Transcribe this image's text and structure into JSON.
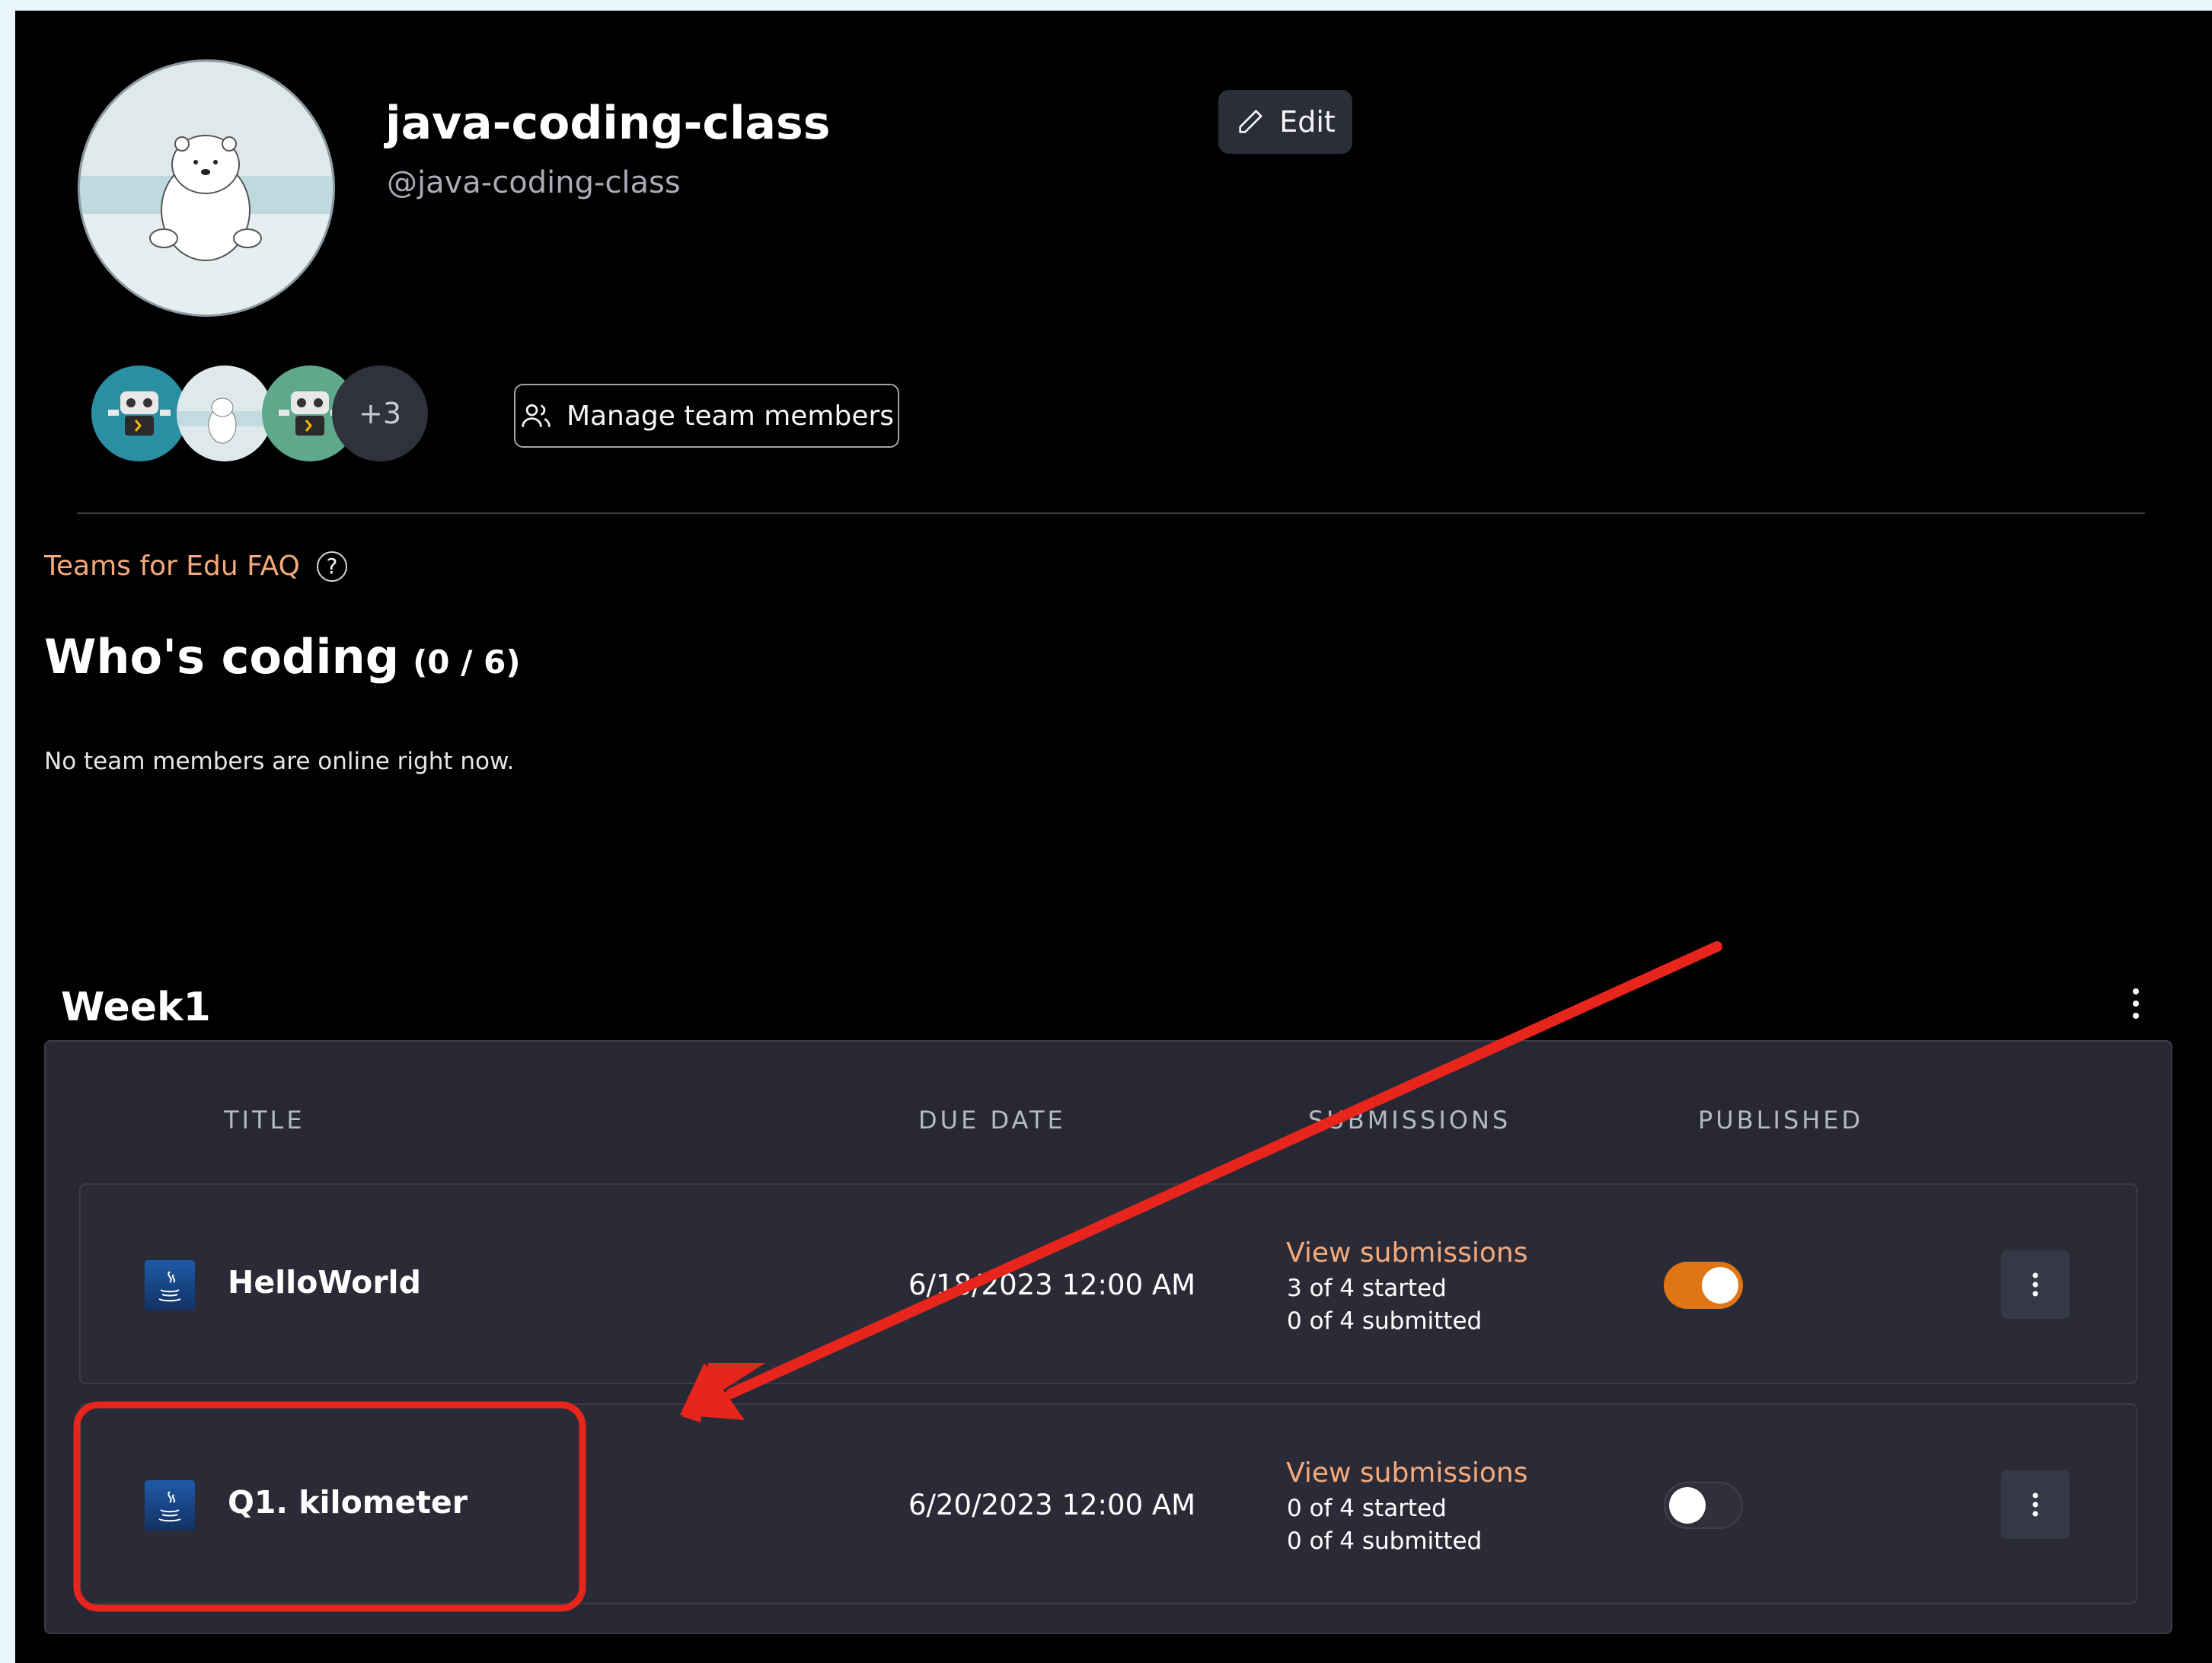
{
  "header": {
    "team_name": "java-coding-class",
    "team_handle": "@java-coding-class",
    "edit_label": "Edit"
  },
  "members": {
    "more_count": "+3",
    "manage_label": "Manage team members"
  },
  "faq": {
    "link_label": "Teams for Edu FAQ",
    "help_glyph": "?"
  },
  "whos_coding": {
    "title": "Who's coding",
    "count": "(0 / 6)",
    "empty_message": "No team members are online right now."
  },
  "week": {
    "title": "Week1",
    "columns": {
      "title": "TITLE",
      "due_date": "DUE DATE",
      "submissions": "SUBMISSIONS",
      "published": "PUBLISHED"
    },
    "rows": [
      {
        "title": "HelloWorld",
        "due_date": "6/18/2023 12:00 AM",
        "view_label": "View submissions",
        "started": "3 of 4 started",
        "submitted": "0 of 4 submitted",
        "published": true
      },
      {
        "title": "Q1. kilometer",
        "due_date": "6/20/2023 12:00 AM",
        "view_label": "View submissions",
        "started": "0 of 4 started",
        "submitted": "0 of 4 submitted",
        "published": false
      }
    ]
  },
  "colors": {
    "accent_orange": "#e07515",
    "link_peach": "#f5a97b",
    "annotation_red": "#e8251c",
    "panel_bg": "#272833"
  }
}
